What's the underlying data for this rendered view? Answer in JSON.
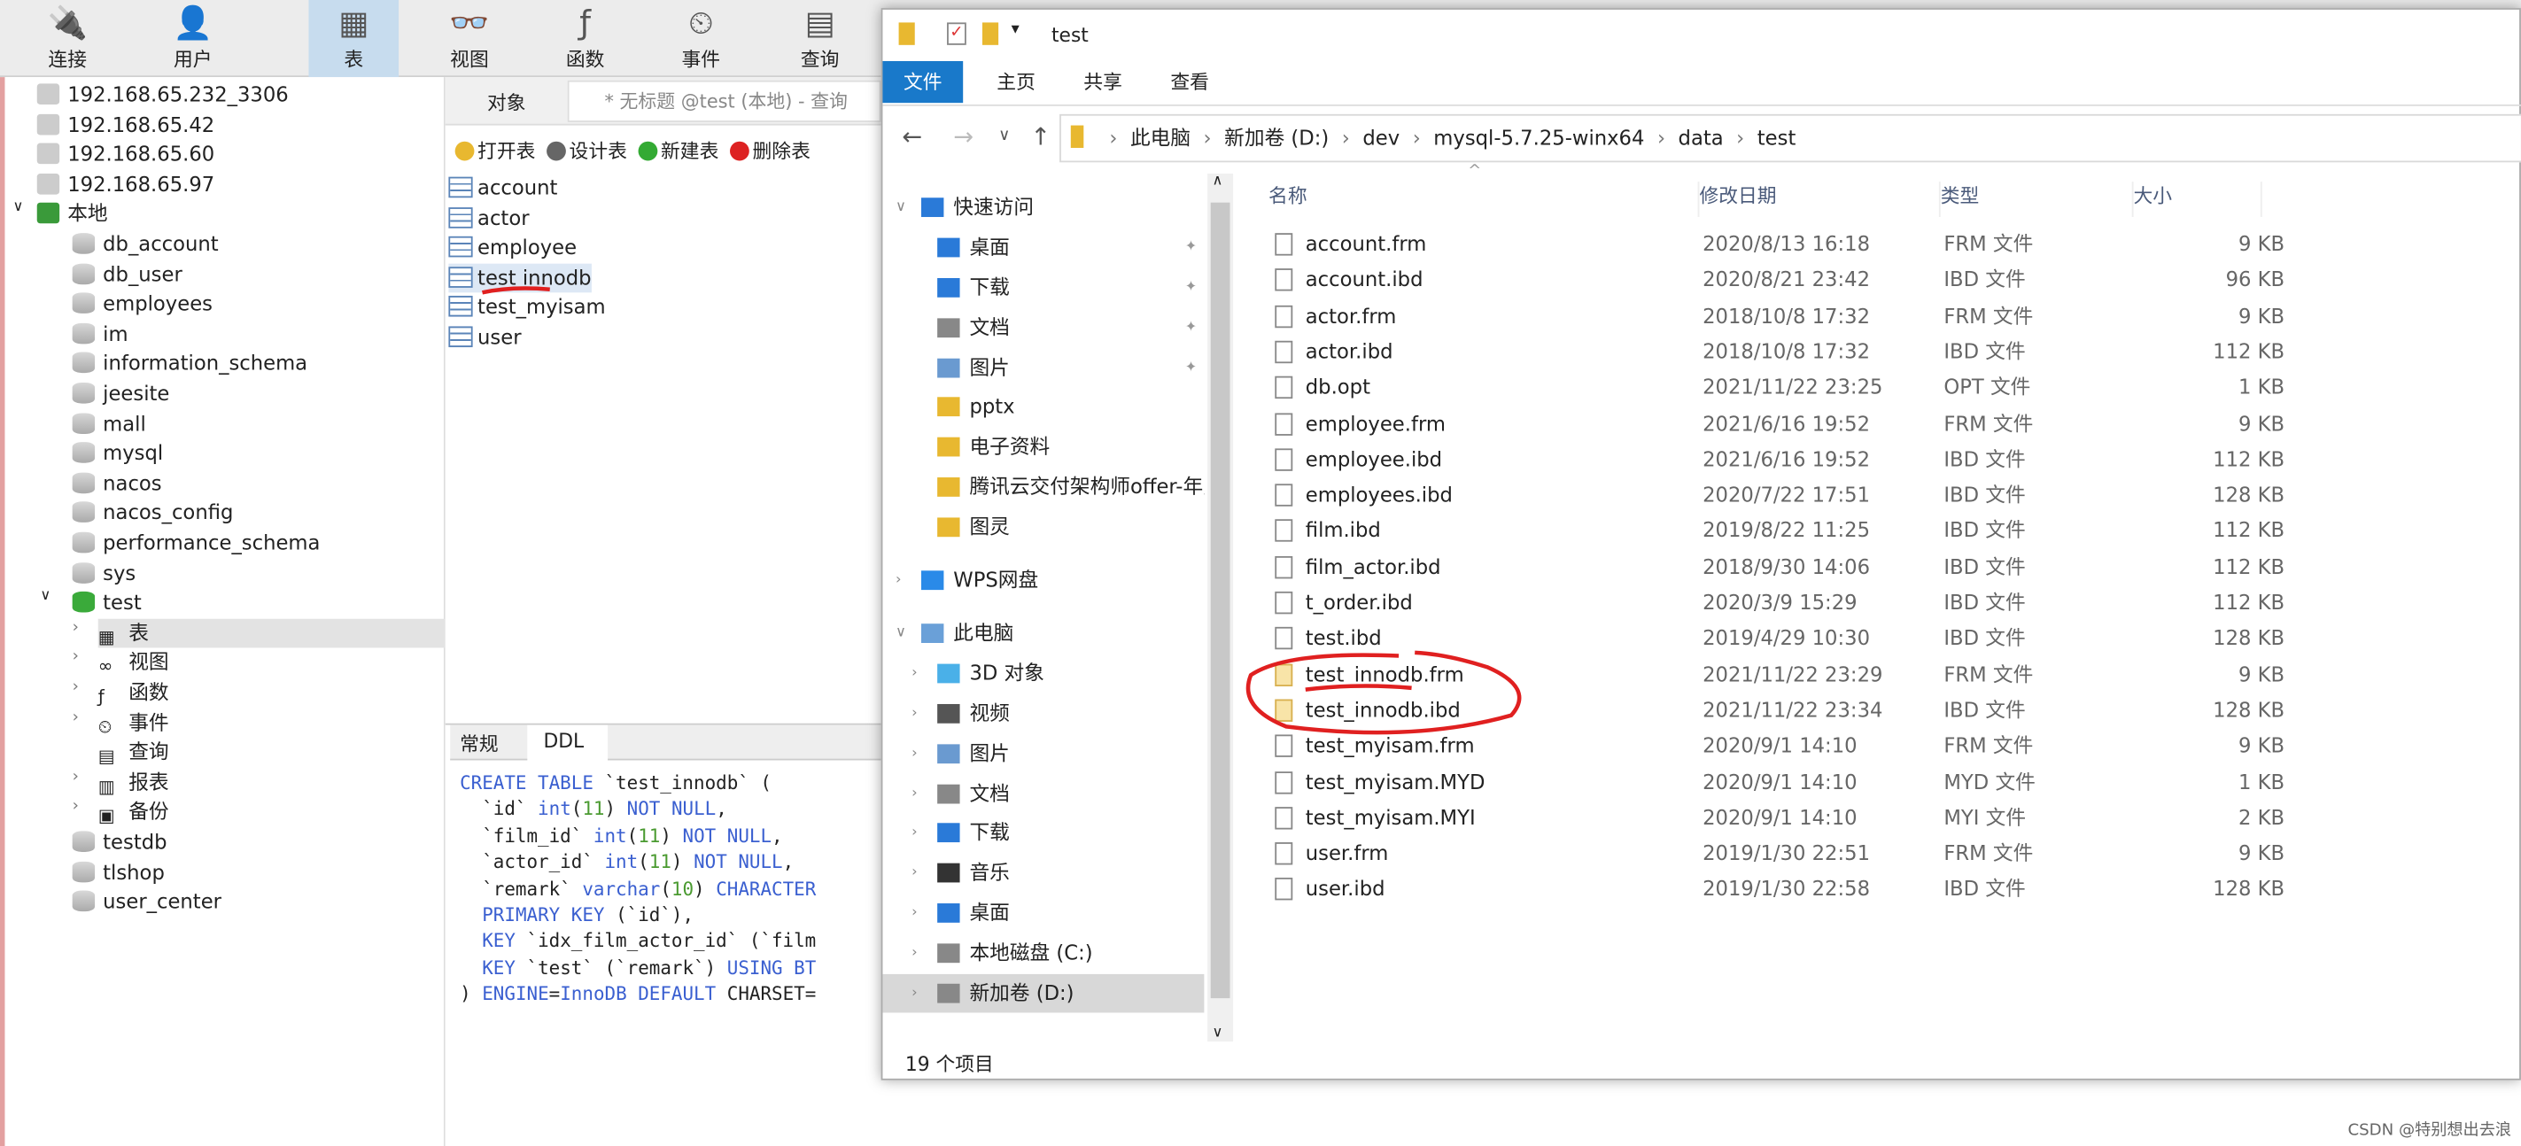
{
  "toolbar": {
    "items": [
      {
        "label": "连接",
        "icon": "plug-icon"
      },
      {
        "label": "用户",
        "icon": "user-icon"
      },
      {
        "label": "表",
        "icon": "table-icon"
      },
      {
        "label": "视图",
        "icon": "view-icon"
      },
      {
        "label": "函数",
        "icon": "function-icon"
      },
      {
        "label": "事件",
        "icon": "event-icon"
      },
      {
        "label": "查询",
        "icon": "query-icon"
      }
    ]
  },
  "tree": {
    "connections": [
      "192.168.65.232_3306",
      "192.168.65.42",
      "192.168.65.60",
      "192.168.65.97"
    ],
    "local": "本地",
    "databases": [
      "db_account",
      "db_user",
      "employees",
      "im",
      "information_schema",
      "jeesite",
      "mall",
      "mysql",
      "nacos",
      "nacos_config",
      "performance_schema",
      "sys",
      "test"
    ],
    "test_children": [
      "表",
      "视图",
      "函数",
      "事件",
      "查询",
      "报表",
      "备份"
    ],
    "after": [
      "testdb",
      "tlshop",
      "user_center"
    ]
  },
  "objects": {
    "tab_label": "对象",
    "query_tab": "* 无标题 @test (本地) - 查询",
    "actions": [
      "打开表",
      "设计表",
      "新建表",
      "删除表"
    ],
    "tables": [
      "account",
      "actor",
      "employee",
      "test innodb",
      "test_myisam",
      "user"
    ]
  },
  "ddl": {
    "tabs": [
      "常规",
      "DDL"
    ]
  },
  "explorer": {
    "title": "test",
    "ribbon": [
      "文件",
      "主页",
      "共享",
      "查看"
    ],
    "path": [
      "此电脑",
      "新加卷 (D:)",
      "dev",
      "mysql-5.7.25-winx64",
      "data",
      "test"
    ],
    "nav": [
      {
        "label": "快速访问",
        "type": "star"
      },
      {
        "label": "桌面",
        "type": "desktop",
        "pin": true
      },
      {
        "label": "下载",
        "type": "download",
        "pin": true
      },
      {
        "label": "文档",
        "type": "doc",
        "pin": true
      },
      {
        "label": "图片",
        "type": "pic",
        "pin": true
      },
      {
        "label": "pptx",
        "type": "folder"
      },
      {
        "label": "电子资料",
        "type": "folder"
      },
      {
        "label": "腾讯云交付架构师offer-年度",
        "type": "folder"
      },
      {
        "label": "图灵",
        "type": "folder"
      },
      {
        "label": "WPS网盘",
        "type": "cloud"
      },
      {
        "label": "此电脑",
        "type": "pc"
      },
      {
        "label": "3D 对象",
        "type": "3d"
      },
      {
        "label": "视频",
        "type": "video"
      },
      {
        "label": "图片",
        "type": "pic"
      },
      {
        "label": "文档",
        "type": "doc"
      },
      {
        "label": "下载",
        "type": "download"
      },
      {
        "label": "音乐",
        "type": "music"
      },
      {
        "label": "桌面",
        "type": "desktop"
      },
      {
        "label": "本地磁盘 (C:)",
        "type": "drive"
      },
      {
        "label": "新加卷 (D:)",
        "type": "drive"
      }
    ],
    "columns": [
      "名称",
      "修改日期",
      "类型",
      "大小"
    ],
    "files": [
      [
        "account.frm",
        "2020/8/13 16:18",
        "FRM 文件",
        "9 KB"
      ],
      [
        "account.ibd",
        "2020/8/21 23:42",
        "IBD 文件",
        "96 KB"
      ],
      [
        "actor.frm",
        "2018/10/8 17:32",
        "FRM 文件",
        "9 KB"
      ],
      [
        "actor.ibd",
        "2018/10/8 17:32",
        "IBD 文件",
        "112 KB"
      ],
      [
        "db.opt",
        "2021/11/22 23:25",
        "OPT 文件",
        "1 KB"
      ],
      [
        "employee.frm",
        "2021/6/16 19:52",
        "FRM 文件",
        "9 KB"
      ],
      [
        "employee.ibd",
        "2021/6/16 19:52",
        "IBD 文件",
        "112 KB"
      ],
      [
        "employees.ibd",
        "2020/7/22 17:51",
        "IBD 文件",
        "128 KB"
      ],
      [
        "film.ibd",
        "2019/8/22 11:25",
        "IBD 文件",
        "112 KB"
      ],
      [
        "film_actor.ibd",
        "2018/9/30 14:06",
        "IBD 文件",
        "112 KB"
      ],
      [
        "t_order.ibd",
        "2020/3/9 15:29",
        "IBD 文件",
        "112 KB"
      ],
      [
        "test.ibd",
        "2019/4/29 10:30",
        "IBD 文件",
        "128 KB"
      ],
      [
        "test_innodb.frm",
        "2021/11/22 23:29",
        "FRM 文件",
        "9 KB"
      ],
      [
        "test_innodb.ibd",
        "2021/11/22 23:34",
        "IBD 文件",
        "128 KB"
      ],
      [
        "test_myisam.frm",
        "2020/9/1 14:10",
        "FRM 文件",
        "9 KB"
      ],
      [
        "test_myisam.MYD",
        "2020/9/1 14:10",
        "MYD 文件",
        "1 KB"
      ],
      [
        "test_myisam.MYI",
        "2020/9/1 14:10",
        "MYI 文件",
        "2 KB"
      ],
      [
        "user.frm",
        "2019/1/30 22:51",
        "FRM 文件",
        "9 KB"
      ],
      [
        "user.ibd",
        "2019/1/30 22:58",
        "IBD 文件",
        "128 KB"
      ]
    ],
    "status": "19 个项目"
  },
  "watermark": "CSDN @特别想出去浪",
  "colors": {
    "accent": "#1979ca",
    "annotation": "#e02020"
  }
}
